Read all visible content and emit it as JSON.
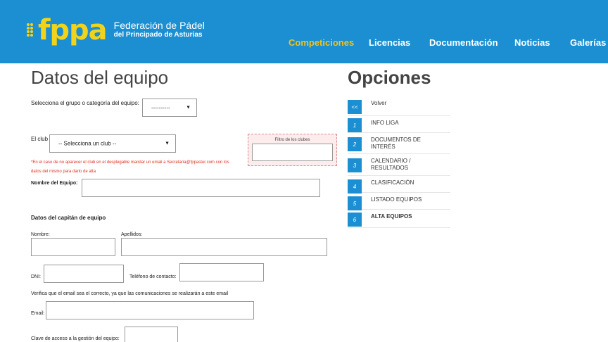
{
  "header": {
    "logo_text": "fppa",
    "logo_line1": "Federación de Pádel",
    "logo_line2": "del Principado de Asturias",
    "nav": [
      "Competiciones",
      "Licencias",
      "Documentación",
      "Noticias",
      "Galerías"
    ],
    "accent_color": "#f2c21b",
    "bar_color": "#1b8fd2"
  },
  "main": {
    "title": "Datos del equipo",
    "group_label": "Selecciona el grupo o categoría del equipo:",
    "group_value": "----------",
    "club_label": "El club",
    "club_value": "-- Selecciona un club --",
    "filter_label": "Filtro de los clubes",
    "notice_line1": "*En el caso de no aparecer el club en el desplegable mandar un email a Secretaria@fppastur.com con los",
    "notice_line2": "datos del mismo para darlo de alta",
    "team_name_label": "Nombre del Equipo:",
    "captain_heading": "Datos del capitán de equipo",
    "nombre_label": "Nombre:",
    "apellidos_label": "Apellidos:",
    "dni_label": "DNI:",
    "telefono_label": "Teléfono de contacto:",
    "email_notice": "Verifica que el email sea el correcto, ya que las comunicaciones se realizarán a este email",
    "email_label": "Email:",
    "password_label": "Clave de acceso a la gestión del equipo:"
  },
  "options": {
    "title": "Opciones",
    "items": [
      {
        "num": "<<",
        "label": "Volver"
      },
      {
        "num": "1",
        "label": "INFO LIGA"
      },
      {
        "num": "2",
        "label": "DOCUMENTOS DE INTERÉS"
      },
      {
        "num": "3",
        "label": "CALENDARIO / RESULTADOS"
      },
      {
        "num": "4",
        "label": "CLASIFICACIÓN"
      },
      {
        "num": "5",
        "label": "LISTADO EQUIPOS"
      },
      {
        "num": "6",
        "label": "ALTA EQUIPOS"
      }
    ]
  }
}
